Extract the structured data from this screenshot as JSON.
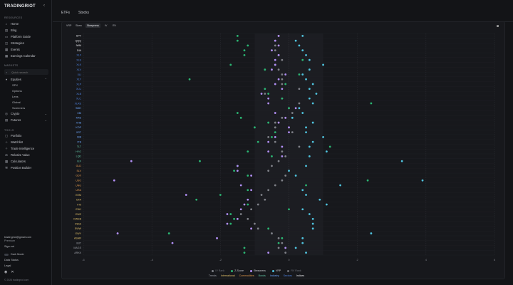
{
  "brand": "TRADINGRIOT",
  "sidebar": {
    "resources_label": "RESOURCES",
    "resources": [
      {
        "label": "Home",
        "icon": "home-icon",
        "glyph": "⌂"
      },
      {
        "label": "Blog",
        "icon": "blog-icon",
        "glyph": "▤"
      },
      {
        "label": "Platform Guide",
        "icon": "book-icon",
        "glyph": "▭"
      },
      {
        "label": "Strategies",
        "icon": "strategy-icon",
        "glyph": "◫"
      },
      {
        "label": "Events",
        "icon": "calendar-icon",
        "glyph": "▦"
      },
      {
        "label": "Earnings Calendar",
        "icon": "calendar-icon",
        "glyph": "▦"
      }
    ],
    "markets_label": "MARKETS",
    "search_placeholder": "Quick search",
    "equities_label": "Equities",
    "equities_sub": [
      "SPX",
      "Options",
      "Lens",
      "Global",
      "Screeners"
    ],
    "crypto_label": "Crypto",
    "futures_label": "Futures",
    "tools_label": "TOOLS",
    "tools": [
      {
        "label": "Portfolio",
        "icon": "portfolio-icon",
        "glyph": "▢"
      },
      {
        "label": "Watchlist",
        "icon": "star-icon",
        "glyph": "☆"
      },
      {
        "label": "Trade Intelligence",
        "icon": "intelligence-icon",
        "glyph": "✧"
      },
      {
        "label": "Relative Value",
        "icon": "scale-icon",
        "glyph": "⚖"
      },
      {
        "label": "Calculators",
        "icon": "calculator-icon",
        "glyph": "▦"
      },
      {
        "label": "Position Builder",
        "icon": "wrench-icon",
        "glyph": "⚒"
      }
    ],
    "email": "tradingriot@gmail.com",
    "plan": "Premium",
    "signout": "Sign out",
    "dark_mode": "Dark Mode",
    "data_status": "Data Status",
    "legal": "Legal",
    "copyright": "© 2026 tradingriot.com"
  },
  "tabs": [
    "ETFs",
    "Stocks"
  ],
  "chart_controls": [
    "VRP",
    "Skew",
    "Steepness",
    "IV",
    "RV"
  ],
  "active_control": "Steepness",
  "colors": {
    "rank": "#7f8188",
    "zscore": "#2bb673",
    "steepness": "#b28ff5",
    "vrp": "#4fc3de",
    "rv_rank": "#6c6e75",
    "trends": "#9ea1a8",
    "international": "#e4c26a",
    "commodities": "#e39a4c",
    "bonds": "#63c7a6",
    "industry": "#6ea8ff",
    "sectors": "#4f86e8",
    "indices": "#e8e9ec"
  },
  "chart_data": {
    "type": "scatter",
    "orientation": "horizontal",
    "xlim": [
      -6,
      6
    ],
    "xticks": [
      -6,
      -4,
      -2,
      0,
      2,
      4,
      6
    ],
    "grid": true,
    "legend_position": "bottom",
    "categories": [
      "SPY",
      "QQQ",
      "IWM",
      "DIA",
      "XLF",
      "XLE",
      "XLK",
      "XLV",
      "XLI",
      "XLY",
      "XLP",
      "XLU",
      "XLB",
      "XLC",
      "XLRE",
      "SMH",
      "XBI",
      "KRE",
      "XHB",
      "KOP",
      "XRT",
      "IBB",
      "ITB",
      "TLT",
      "HYG",
      "LQD",
      "IEF",
      "GLD",
      "SLV",
      "GDX",
      "USO",
      "UNG",
      "URA",
      "EEM",
      "EFA",
      "FXI",
      "EWJ",
      "EWZ",
      "KWEB",
      "INDA",
      "EWW",
      "EWY",
      "ASHR",
      "IBIT",
      "MAGS",
      "ARKK"
    ],
    "category_groups": [
      "indices",
      "indices",
      "indices",
      "indices",
      "sectors",
      "sectors",
      "sectors",
      "sectors",
      "sectors",
      "sectors",
      "sectors",
      "sectors",
      "sectors",
      "sectors",
      "sectors",
      "industry",
      "industry",
      "industry",
      "industry",
      "industry",
      "industry",
      "industry",
      "industry",
      "bonds",
      "bonds",
      "bonds",
      "bonds",
      "commodities",
      "commodities",
      "commodities",
      "commodities",
      "commodities",
      "commodities",
      "international",
      "international",
      "international",
      "international",
      "international",
      "international",
      "international",
      "international",
      "international",
      "international",
      "trends",
      "trends",
      "trends"
    ],
    "series": [
      {
        "name": "IV Rank",
        "key": "rank",
        "values": [
          -0.3,
          -0.4,
          -0.4,
          -0.4,
          -0.3,
          -0.2,
          -0.4,
          -0.3,
          -0.2,
          -0.2,
          -0.2,
          0.3,
          -0.7,
          -0.2,
          0.3,
          0.0,
          0.1,
          -0.2,
          -0.4,
          -0.4,
          0.1,
          -0.6,
          -0.4,
          0.3,
          -0.2,
          -0.1,
          -0.3,
          -0.5,
          -0.6,
          -0.1,
          -0.2,
          -0.4,
          -0.6,
          -0.8,
          -0.7,
          -0.9,
          -1.1,
          -1.4,
          -1.2,
          -1.0,
          -0.9,
          -0.5,
          -0.3,
          -0.2,
          -0.3,
          -0.1
        ]
      },
      {
        "name": "Z-Score",
        "key": "zscore",
        "values": [
          -1.5,
          -1.5,
          -1.2,
          -1.3,
          -1.3,
          0.4,
          -1.7,
          -0.7,
          0.3,
          -2.9,
          -0.1,
          -0.7,
          -0.6,
          -0.2,
          2.4,
          0.0,
          -1.5,
          -1.4,
          -0.6,
          -1.0,
          -0.4,
          -0.5,
          -0.9,
          1.2,
          -1.2,
          -0.5,
          -2.6,
          -1.5,
          -1.6,
          -1.2,
          2.3,
          0.5,
          -1.2,
          -2.0,
          -2.7,
          -1.2,
          0.0,
          -1.7,
          -1.6,
          -1.7,
          -0.6,
          -3.5,
          -0.2,
          -0.3,
          -1.3,
          -1.3
        ]
      },
      {
        "name": "Steepness",
        "key": "steepness",
        "values": [
          -0.3,
          -0.4,
          -0.3,
          -0.5,
          -0.3,
          -0.4,
          -0.4,
          -0.5,
          -0.1,
          -0.3,
          -0.4,
          -0.2,
          -0.8,
          -0.6,
          -0.6,
          0.2,
          -0.4,
          -0.1,
          -0.3,
          0.0,
          0.0,
          -0.4,
          -0.6,
          -0.2,
          -0.6,
          -0.2,
          -4.6,
          -1.5,
          -1.5,
          -1.1,
          -5.1,
          -1.4,
          -1.1,
          -3.0,
          -1.2,
          -1.3,
          -1.4,
          -1.8,
          -1.5,
          -1.8,
          -1.1,
          -5.0,
          -2.1,
          -3.4,
          -0.1,
          -0.6
        ]
      },
      {
        "name": "VRP",
        "key": "vrp",
        "values": [
          0.4,
          0.2,
          0.3,
          0.4,
          0.5,
          0.6,
          1.0,
          0.6,
          0.4,
          0.5,
          0.7,
          0.6,
          0.8,
          0.6,
          0.7,
          0.3,
          0.4,
          0.1,
          0.7,
          0.5,
          0.5,
          1.0,
          0.7,
          0.6,
          1.1,
          0.6,
          3.3,
          0.5,
          0.0,
          0.2,
          3.9,
          1.5,
          0.4,
          0.5,
          0.9,
          1.1,
          0.4,
          0.6,
          0.7,
          0.7,
          0.7,
          2.4,
          0.4,
          0.4,
          0.2,
          0.5
        ]
      }
    ],
    "legend_series": [
      "IV Rank",
      "Z-Score",
      "Steepness",
      "VRP",
      "RV Rank"
    ],
    "legend_groups": [
      "Trends",
      "International",
      "Commodities",
      "Bonds",
      "Industry",
      "Sectors",
      "Indices"
    ]
  }
}
